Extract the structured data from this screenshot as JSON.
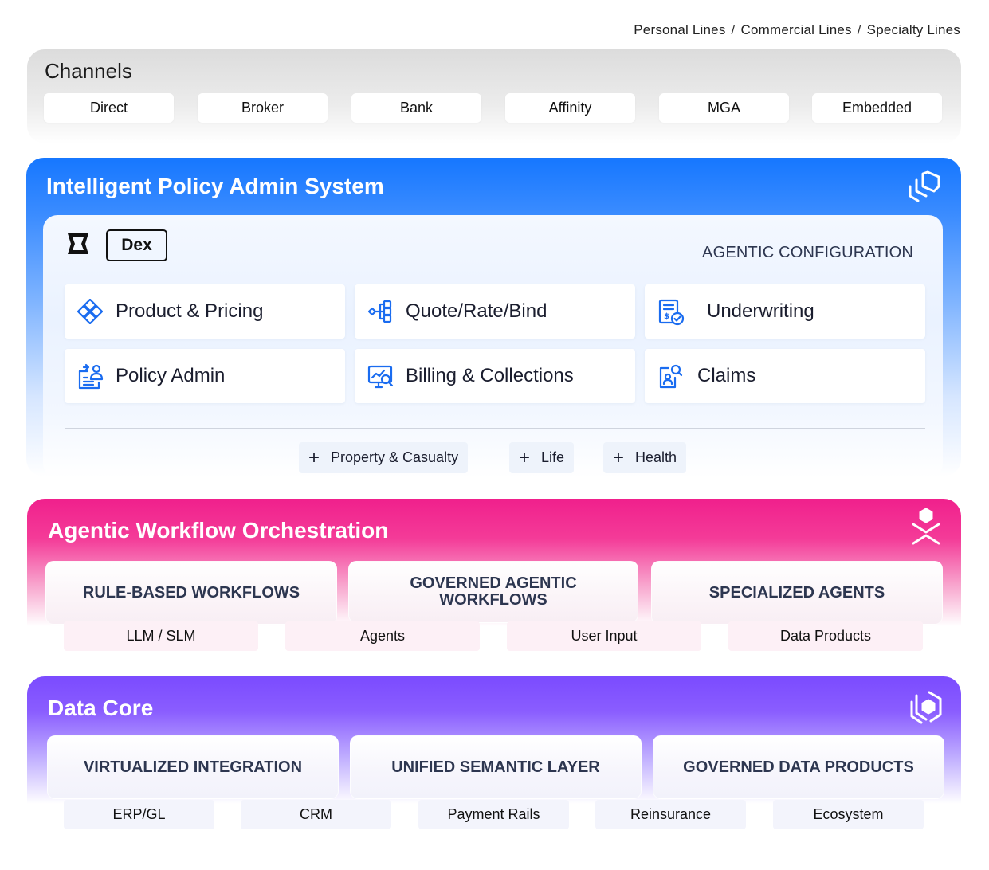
{
  "lines": [
    "Personal Lines",
    "Commercial Lines",
    "Specialty Lines"
  ],
  "line_separator": "/",
  "channels": {
    "title": "Channels",
    "items": [
      "Direct",
      "Broker",
      "Bank",
      "Affinity",
      "MGA",
      "Embedded"
    ]
  },
  "pas": {
    "title": "Intelligent Policy Admin System",
    "dex_label": "Dex",
    "config_label": "AGENTIC CONFIGURATION",
    "modules": [
      {
        "label": "Product & Pricing",
        "icon": "puzzle-icon"
      },
      {
        "label": "Quote/Rate/Bind",
        "icon": "flow-icon"
      },
      {
        "label": "Underwriting",
        "icon": "document-check-icon"
      },
      {
        "label": "Policy Admin",
        "icon": "policy-icon"
      },
      {
        "label": "Billing & Collections",
        "icon": "chart-search-icon"
      },
      {
        "label": "Claims",
        "icon": "claims-icon"
      }
    ],
    "lines_of_business": [
      "Property & Casualty",
      "Life",
      "Health"
    ],
    "plus_symbol": "+"
  },
  "awo": {
    "title": "Agentic Workflow Orchestration",
    "cards": [
      "RULE-BASED WORKFLOWS",
      "GOVERNED AGENTIC WORKFLOWS",
      "SPECIALIZED AGENTS"
    ],
    "pills": [
      "LLM / SLM",
      "Agents",
      "User Input",
      "Data Products"
    ]
  },
  "data_core": {
    "title": "Data Core",
    "cards": [
      "VIRTUALIZED INTEGRATION",
      "UNIFIED SEMANTIC LAYER",
      "GOVERNED DATA PRODUCTS"
    ],
    "pills": [
      "ERP/GL",
      "CRM",
      "Payment Rails",
      "Reinsurance",
      "Ecosystem"
    ]
  },
  "colors": {
    "pas_blue": "#1677ff",
    "awo_pink": "#f0208c",
    "data_purple": "#7b4bff",
    "icon_blue": "#1a6cf0",
    "heading_text": "#2d3650"
  }
}
